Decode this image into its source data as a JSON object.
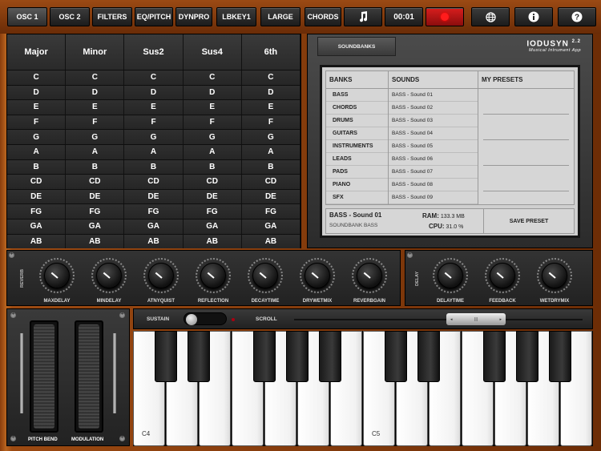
{
  "toolbar": {
    "buttons": [
      "OSC 1",
      "OSC 2",
      "FILTERS",
      "EQ/PITCH",
      "DYNPRO",
      "LBKEY1",
      "LARGE",
      "CHORDS"
    ],
    "time": "00:01",
    "icons": [
      "music-note-icon",
      "globe-icon",
      "info-icon",
      "help-icon"
    ]
  },
  "chords": {
    "headers": [
      "Major",
      "Minor",
      "Sus2",
      "Sus4",
      "6th"
    ],
    "rows": [
      "C",
      "D",
      "E",
      "F",
      "G",
      "A",
      "B",
      "CD",
      "DE",
      "FG",
      "GA",
      "AB"
    ]
  },
  "soundbanks": {
    "tab": "SOUNDBANKS",
    "logo": "IODUSYN",
    "version": "2.2",
    "subtitle": "Musical Intrument App",
    "headers": {
      "banks": "BANKS",
      "sounds": "SOUNDS",
      "presets": "MY PRESETS"
    },
    "banks": [
      "BASS",
      "CHORDS",
      "DRUMS",
      "GUITARS",
      "INSTRUMENTS",
      "LEADS",
      "PADS",
      "PIANO",
      "SFX"
    ],
    "sounds": [
      "BASS - Sound 01",
      "BASS - Sound 02",
      "BASS - Sound 03",
      "BASS - Sound 04",
      "BASS - Sound 05",
      "BASS - Sound 06",
      "BASS - Sound 07",
      "BASS - Sound 08",
      "BASS - Sound 09"
    ],
    "current_sound": "BASS - Sound 01",
    "current_bank": "SOUNDBANK BASS",
    "ram_label": "RAM:",
    "ram_value": "133.3 MB",
    "cpu_label": "CPU:",
    "cpu_value": "31.0  %",
    "save_preset": "SAVE PRESET"
  },
  "reverb": {
    "label": "REVERB",
    "knobs": [
      "MAXDELAY",
      "MINDELAY",
      "ATNYQUIST",
      "REFLECTION",
      "DECAYTIME",
      "DRYWETMIX",
      "REVERBGAIN"
    ]
  },
  "delay": {
    "label": "DELAY",
    "knobs": [
      "DELAYTIME",
      "FEEDBACK",
      "WETDRYMIX"
    ]
  },
  "wheels": {
    "pitch": "PITCH BEND",
    "mod": "MODULATION"
  },
  "controls": {
    "sustain": "SUSTAIN",
    "scroll": "SCROLL"
  },
  "keyboard": {
    "c4": "C4",
    "c5": "C5"
  }
}
